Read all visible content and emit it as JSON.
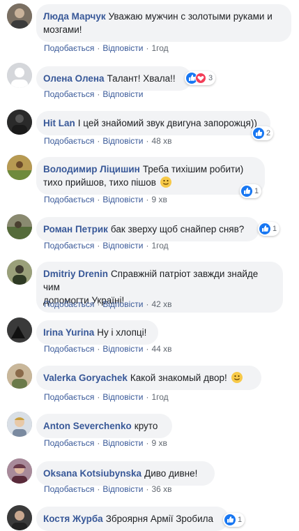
{
  "like_label": "Подобається",
  "reply_label": "Відповісти",
  "comments": [
    {
      "author": "Люда Марчук",
      "text_l1": "Уважаю мужчин с золотыми руками и",
      "text_l2": "мозгами!",
      "time": "1год",
      "reactions": null
    },
    {
      "author": "Олена Олена",
      "text": "Талант! Хвала!!",
      "time": "",
      "reactions": {
        "count": "3",
        "types": [
          "like",
          "love"
        ]
      }
    },
    {
      "author": "Hit Lan",
      "text": "І цей знайомий звук двигуна запорожця))",
      "time": "48 хв",
      "reactions": {
        "count": "2",
        "types": [
          "like"
        ]
      }
    },
    {
      "author": "Володимир Ліцишин",
      "text_l1": "Треба тихішим робити)",
      "text_l2": "тихо прийшов, тихо пішов",
      "emoji": "smile",
      "time": "9 хв",
      "reactions": {
        "count": "1",
        "types": [
          "like"
        ]
      }
    },
    {
      "author": "Роман Петрик",
      "text": "бак зверху щоб снайпер сняв?",
      "time": "1год",
      "reactions": {
        "count": "1",
        "types": [
          "like"
        ]
      }
    },
    {
      "author": "Dmitriy Drenin",
      "text_l1": "Справжній патріот завжди знайде чим",
      "text_l2": "допомогти Україні!",
      "time": "42 хв",
      "reactions": null
    },
    {
      "author": "Irina Yurina",
      "text": "Ну і хлопці!",
      "time": "44 хв",
      "reactions": null
    },
    {
      "author": "Valerka Goryachek",
      "text": "Какой знакомый двор!",
      "emoji": "smile",
      "time": "1год",
      "reactions": null
    },
    {
      "author": "Anton Severchenko",
      "text": "круто",
      "time": "9 хв",
      "reactions": null
    },
    {
      "author": "Oksana Kotsiubynska",
      "text": "Диво дивне!",
      "time": "36 хв",
      "reactions": null
    },
    {
      "author": "Костя Журба",
      "text": "Зброярня Армії Зробила",
      "time": "",
      "reactions": {
        "count": "1",
        "types": [
          "like"
        ]
      }
    }
  ],
  "colors": {
    "author": "#385898",
    "bubble": "#f2f3f5",
    "meta": "#606770",
    "like": "#1877f2",
    "love": "#f33e58"
  }
}
